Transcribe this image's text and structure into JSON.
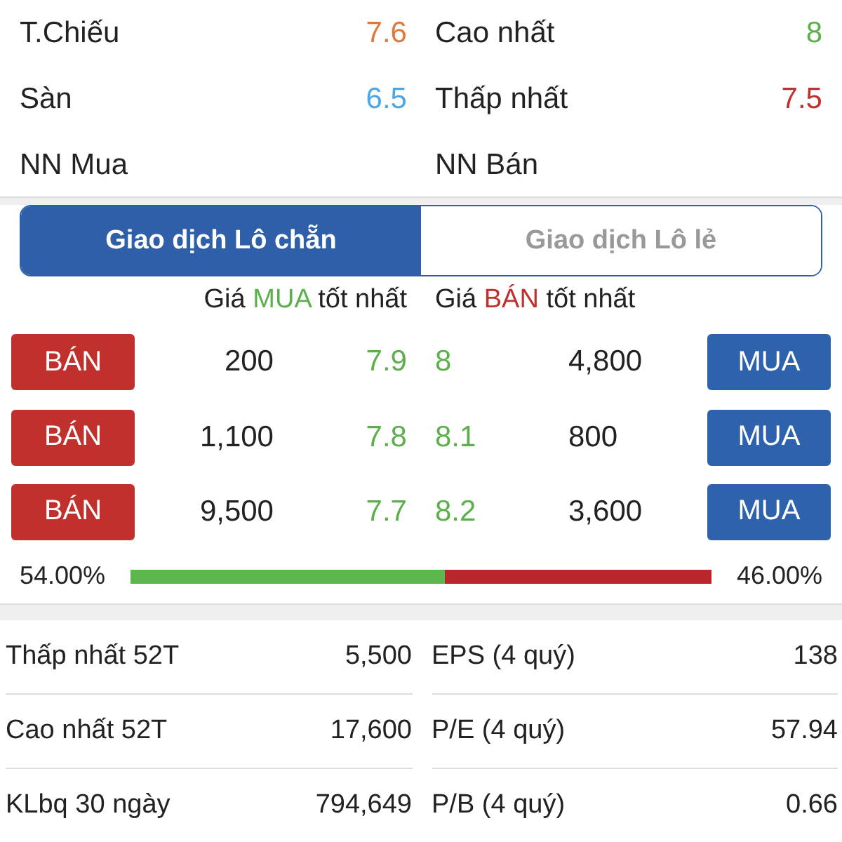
{
  "summary": [
    {
      "label": "T.Chiếu",
      "value": "7.6",
      "color": "#e07a3c"
    },
    {
      "label": "Cao nhất",
      "value": "8",
      "color": "#5cb04c"
    },
    {
      "label": "Sàn",
      "value": "6.5",
      "color": "#4aa8e8"
    },
    {
      "label": "Thấp nhất",
      "value": "7.5",
      "color": "#c0302c"
    },
    {
      "label": "NN Mua"
    },
    {
      "label": "NN Bán"
    }
  ],
  "tabs": [
    {
      "label": "Giao dịch Lô chẵn",
      "selected": true
    },
    {
      "label": "Giao dịch Lô lẻ",
      "selected": false
    }
  ],
  "book_headers": [
    {
      "prefix": "Giá",
      "highlight": "MUA",
      "suffix": "tốt nhất",
      "color": "#5cb04c"
    },
    {
      "prefix": "Giá",
      "highlight": "BÁN",
      "suffix": "tốt nhất",
      "color": "#c0302c"
    }
  ],
  "orders": [
    {
      "sell_button": "BÁN",
      "bid_volume": "200",
      "bid_price": "7.9",
      "ask_price": "8",
      "ask_volume": "4,800",
      "buy_button": "MUA"
    },
    {
      "sell_button": "BÁN",
      "bid_volume": "1,100",
      "bid_price": "7.8",
      "ask_price": "8.1",
      "ask_volume": "800",
      "buy_button": "MUA"
    },
    {
      "sell_button": "BÁN",
      "bid_volume": "9,500",
      "bid_price": "7.7",
      "ask_price": "8.2",
      "ask_volume": "3,600",
      "buy_button": "MUA"
    }
  ],
  "ratio": {
    "buy_percent": "54.00%",
    "level": 0.54,
    "sell_percent": "46.00%"
  },
  "fundamentals": [
    {
      "label": "Thấp nhất 52T",
      "value": "5,500"
    },
    {
      "label": "EPS (4 quý)",
      "value": "138"
    },
    {
      "label": "Cao nhất 52T",
      "value": "17,600"
    },
    {
      "label": "P/E (4 quý)",
      "value": "57.94"
    },
    {
      "label": "KLbq 30 ngày",
      "value": "794,649"
    },
    {
      "label": "P/B (4 quý)",
      "value": "0.66"
    }
  ]
}
